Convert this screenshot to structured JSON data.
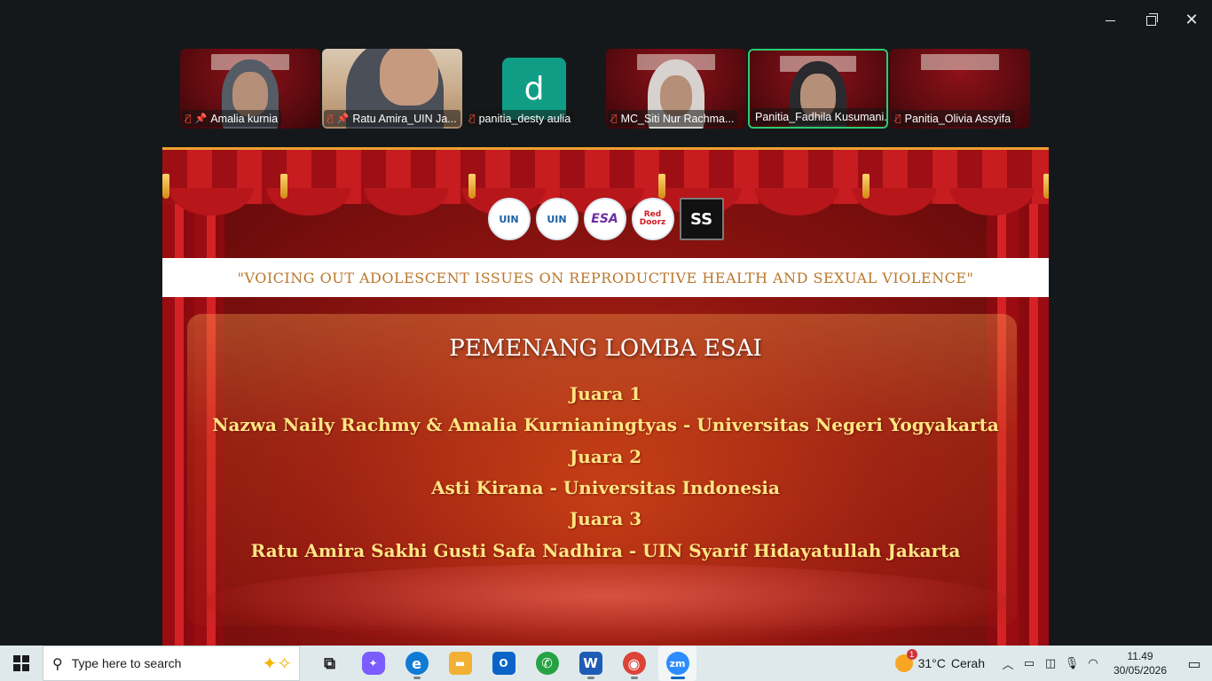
{
  "window": {
    "minimize_icon": "minimize-icon",
    "maximize_icon": "restore-icon",
    "close_icon": "close-icon"
  },
  "participants": [
    {
      "name": "Amalia kurnia",
      "muted": true,
      "pinned": true
    },
    {
      "name": "Ratu Amira_UIN Ja...",
      "muted": true,
      "pinned": true
    },
    {
      "name": "panitia_desty aulia",
      "muted": true,
      "pinned": false,
      "avatar_letter": "d"
    },
    {
      "name": "MC_Siti Nur Rachma...",
      "muted": true,
      "pinned": false
    },
    {
      "name": "Panitia_Fadhila Kusumani...",
      "muted": false,
      "pinned": false,
      "active_speaker": true
    },
    {
      "name": "Panitia_Olivia Assyifa",
      "muted": true,
      "pinned": false
    }
  ],
  "slide": {
    "logos": [
      {
        "name": "uin-logo",
        "text": "UIN"
      },
      {
        "name": "uin-faculty-logo",
        "text": "UIN"
      },
      {
        "name": "esa-logo",
        "text": "ESA"
      },
      {
        "name": "reddoorz-logo",
        "text": "Red Doorz"
      },
      {
        "name": "ss-warung-logo",
        "text": "SS"
      }
    ],
    "subtitle": "\"VOICING OUT ADOLESCENT ISSUES ON REPRODUCTIVE HEALTH AND SEXUAL VIOLENCE\"",
    "title": "PEMENANG LOMBA ESAI",
    "winners": [
      {
        "rank": "Juara 1",
        "name": "Nazwa Naily Rachmy & Amalia Kurnianingtyas - Universitas Negeri Yogyakarta"
      },
      {
        "rank": "Juara 2",
        "name": "Asti Kirana - Universitas Indonesia"
      },
      {
        "rank": "Juara 3",
        "name": "Ratu Amira Sakhi Gusti Safa Nadhira - UIN Syarif Hidayatullah Jakarta"
      }
    ]
  },
  "taskbar": {
    "search_placeholder": "Type here to search",
    "apps": [
      {
        "name": "task-view",
        "label": "⧉",
        "color": "#3a3a3a"
      },
      {
        "name": "copilot",
        "label": "✦",
        "color": "#7b5cff"
      },
      {
        "name": "edge",
        "label": "e",
        "color": "#0f7bd6"
      },
      {
        "name": "file-explorer",
        "label": "▬",
        "color": "#f2b134"
      },
      {
        "name": "outlook",
        "label": "O",
        "color": "#0a64c8"
      },
      {
        "name": "whatsapp",
        "label": "✆",
        "color": "#25a244"
      },
      {
        "name": "word",
        "label": "W",
        "color": "#1f5cb5"
      },
      {
        "name": "chrome",
        "label": "◉",
        "color": "#db4437"
      },
      {
        "name": "zoom",
        "label": "zm",
        "color": "#2d8cff"
      }
    ],
    "weather": {
      "temp": "31°C",
      "condition": "Cerah"
    },
    "clock": {
      "time": "11.49",
      "date": "30/05/2026"
    }
  }
}
